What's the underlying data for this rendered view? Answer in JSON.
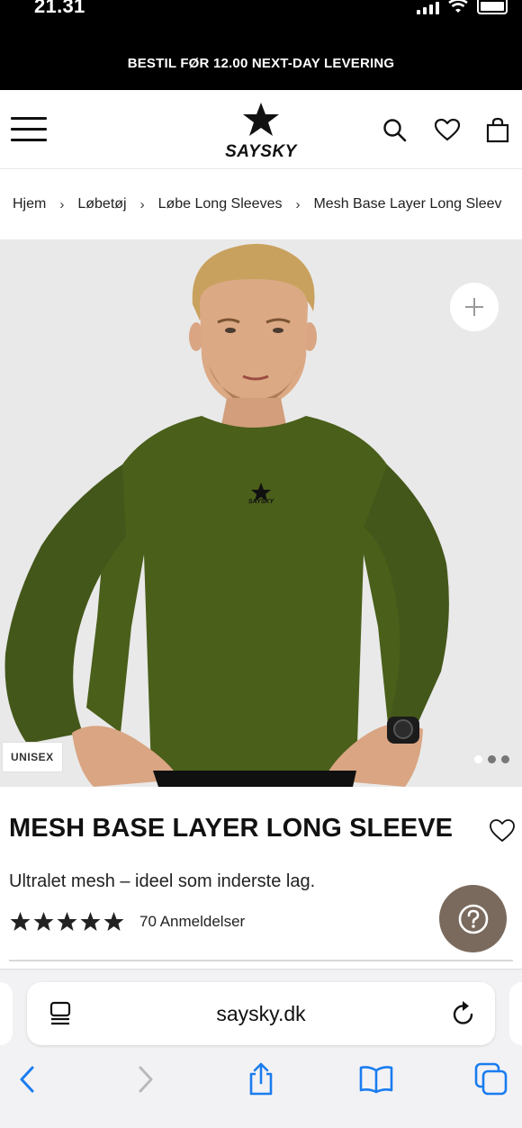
{
  "status_bar": {
    "time": "21.31"
  },
  "promo_banner": {
    "text": "BESTIL FØR 12.00 NEXT-DAY LEVERING"
  },
  "header": {
    "logo_text": "SAYSKY",
    "icons": [
      "menu-icon",
      "search-icon",
      "heart-icon",
      "shopping-bag-icon"
    ]
  },
  "breadcrumb": {
    "items": [
      "Hjem",
      "Løbetøj",
      "Løbe Long Sleeves",
      "Mesh Base Layer Long Sleev"
    ],
    "separator": "›"
  },
  "product_image": {
    "badge": "UNISEX",
    "chest_logo": "SAYSKY",
    "total_images": 3,
    "active_image_index": 2
  },
  "product": {
    "title": "MESH BASE LAYER LONG SLEEVE",
    "subtitle": "Ultralet mesh – ideel som inderste lag.",
    "rating_stars": 5,
    "reviews_text": "70 Anmeldelser"
  },
  "colors": {
    "shirt": "#4a5f1a",
    "help_button": "#7a6a5d",
    "accent_blue": "#1a7cf0"
  },
  "safari": {
    "url": "saysky.dk",
    "toolbar_icons": [
      "back-icon",
      "forward-icon",
      "share-icon",
      "bookmarks-icon",
      "tabs-icon"
    ]
  }
}
